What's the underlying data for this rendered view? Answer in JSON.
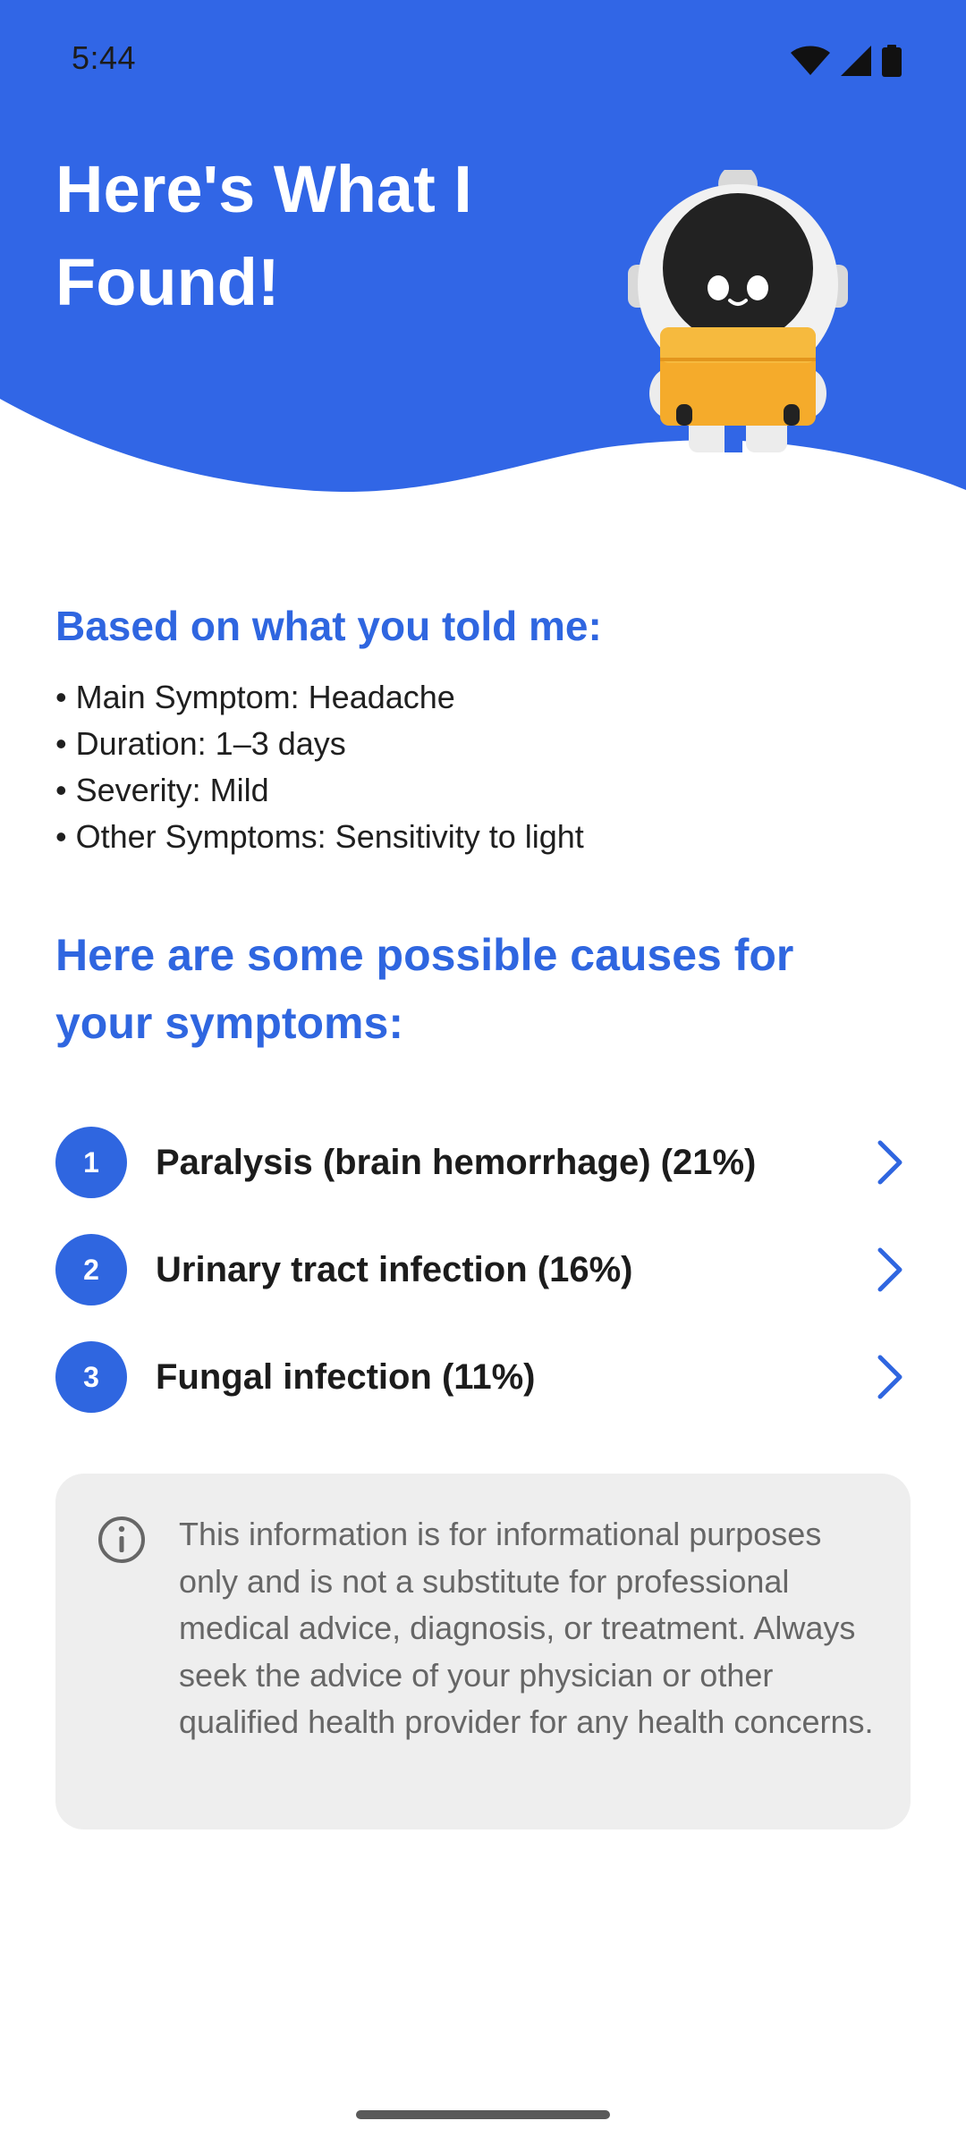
{
  "status_bar": {
    "time": "5:44",
    "icons": [
      "wifi-icon",
      "cellular-signal-icon",
      "battery-icon"
    ]
  },
  "header": {
    "title": "Here's What I Found!",
    "mascot": "astronaut-robot-mascot",
    "background_color": "#3166e6"
  },
  "summary": {
    "title": "Based on what you told me:",
    "items": [
      "Main Symptom: Headache",
      "Duration: 1–3 days",
      "Severity: Mild",
      "Other Symptoms: Sensitivity to light"
    ]
  },
  "causes": {
    "title": "Here are some possible causes for your symptoms:",
    "items": [
      {
        "number": "1",
        "label": "Paralysis (brain hemorrhage) (21%)"
      },
      {
        "number": "2",
        "label": "Urinary tract infection (16%)"
      },
      {
        "number": "3",
        "label": "Fungal infection (11%)"
      }
    ]
  },
  "disclaimer": {
    "icon": "info-icon",
    "text": "This information is for informational purposes only and is not a substitute for professional medical advice, diagnosis, or treatment. Always seek the advice of your physician or other qualified health provider for any health concerns."
  },
  "colors": {
    "accent": "#2f66e0",
    "disclaimer_bg": "#eeeeee",
    "text_primary": "#1c1c1c"
  }
}
